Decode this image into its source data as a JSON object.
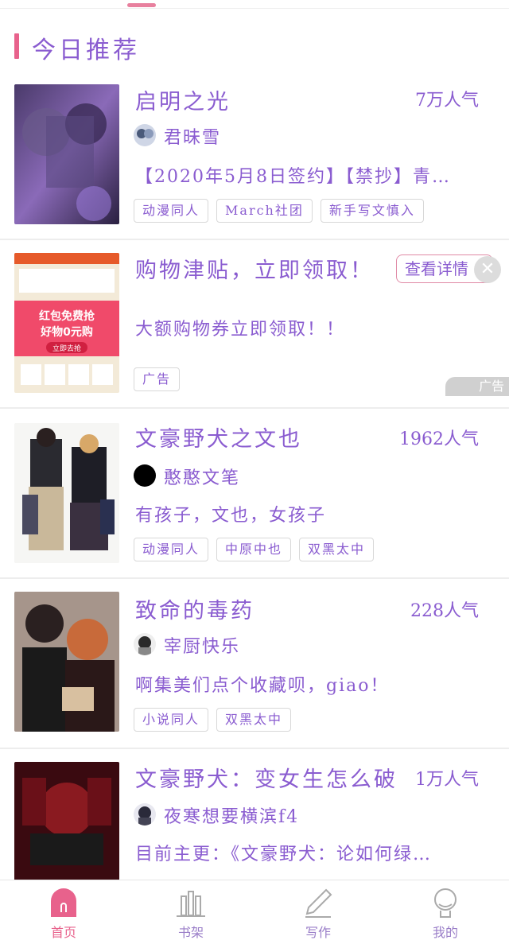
{
  "section": {
    "title": "今日推荐"
  },
  "items": [
    {
      "title": "启明之光",
      "popularity": "7万人气",
      "author": "君昧雪",
      "description": "【2020年5月8日签约】【禁抄】青…",
      "tags": [
        "动漫同人",
        "March社团",
        "新手写文慎入"
      ]
    },
    {
      "title": "文豪野犬之文也",
      "popularity": "1962人气",
      "author": "憨憨文笔",
      "description": "有孩子，文也，女孩子",
      "tags": [
        "动漫同人",
        "中原中也",
        "双黑太中"
      ]
    },
    {
      "title": "致命的毒药",
      "popularity": "228人气",
      "author": "宰厨快乐",
      "description": "啊集美们点个收藏呗，giao！",
      "tags": [
        "小说同人",
        "双黑太中"
      ]
    },
    {
      "title": "文豪野犬：变女生怎么破",
      "popularity": "1万人气",
      "author": "夜寒想要横滨f4",
      "description": "目前主更：《文豪野犬：论如何绿…"
    }
  ],
  "ad": {
    "title": "购物津贴，立即领取！",
    "button_label": "查看详情",
    "description": "大额购物券立即领取！！",
    "tag": "广告",
    "mark": "广告",
    "cover_line1": "红包免费抢",
    "cover_line2": "好物0元购",
    "cover_button": "立即去抢"
  },
  "nav": [
    {
      "label": "首页",
      "icon": "home-arch-icon",
      "active": true
    },
    {
      "label": "书架",
      "icon": "bookshelf-icon",
      "active": false
    },
    {
      "label": "写作",
      "icon": "pen-icon",
      "active": false
    },
    {
      "label": "我的",
      "icon": "profile-icon",
      "active": false
    }
  ],
  "colors": {
    "accent": "#e8628c",
    "text": "#8a5cd0",
    "inactive_nav": "#9a7ec8"
  }
}
